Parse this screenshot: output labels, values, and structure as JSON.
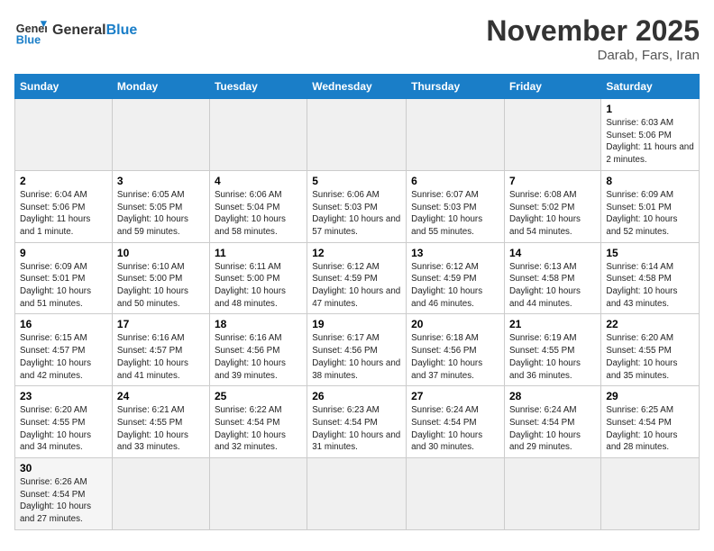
{
  "header": {
    "logo_line1": "General",
    "logo_line2": "Blue",
    "title": "November 2025",
    "subtitle": "Darab, Fars, Iran"
  },
  "weekdays": [
    "Sunday",
    "Monday",
    "Tuesday",
    "Wednesday",
    "Thursday",
    "Friday",
    "Saturday"
  ],
  "weeks": [
    [
      {
        "day": "",
        "empty": true
      },
      {
        "day": "",
        "empty": true
      },
      {
        "day": "",
        "empty": true
      },
      {
        "day": "",
        "empty": true
      },
      {
        "day": "",
        "empty": true
      },
      {
        "day": "",
        "empty": true
      },
      {
        "day": "1",
        "sunrise": "6:03 AM",
        "sunset": "5:06 PM",
        "daylight": "11 hours and 2 minutes."
      }
    ],
    [
      {
        "day": "2",
        "sunrise": "6:04 AM",
        "sunset": "5:06 PM",
        "daylight": "11 hours and 1 minute."
      },
      {
        "day": "3",
        "sunrise": "6:05 AM",
        "sunset": "5:05 PM",
        "daylight": "10 hours and 59 minutes."
      },
      {
        "day": "4",
        "sunrise": "6:06 AM",
        "sunset": "5:04 PM",
        "daylight": "10 hours and 58 minutes."
      },
      {
        "day": "5",
        "sunrise": "6:06 AM",
        "sunset": "5:03 PM",
        "daylight": "10 hours and 57 minutes."
      },
      {
        "day": "6",
        "sunrise": "6:07 AM",
        "sunset": "5:03 PM",
        "daylight": "10 hours and 55 minutes."
      },
      {
        "day": "7",
        "sunrise": "6:08 AM",
        "sunset": "5:02 PM",
        "daylight": "10 hours and 54 minutes."
      },
      {
        "day": "8",
        "sunrise": "6:09 AM",
        "sunset": "5:01 PM",
        "daylight": "10 hours and 52 minutes."
      }
    ],
    [
      {
        "day": "9",
        "sunrise": "6:09 AM",
        "sunset": "5:01 PM",
        "daylight": "10 hours and 51 minutes."
      },
      {
        "day": "10",
        "sunrise": "6:10 AM",
        "sunset": "5:00 PM",
        "daylight": "10 hours and 50 minutes."
      },
      {
        "day": "11",
        "sunrise": "6:11 AM",
        "sunset": "5:00 PM",
        "daylight": "10 hours and 48 minutes."
      },
      {
        "day": "12",
        "sunrise": "6:12 AM",
        "sunset": "4:59 PM",
        "daylight": "10 hours and 47 minutes."
      },
      {
        "day": "13",
        "sunrise": "6:12 AM",
        "sunset": "4:59 PM",
        "daylight": "10 hours and 46 minutes."
      },
      {
        "day": "14",
        "sunrise": "6:13 AM",
        "sunset": "4:58 PM",
        "daylight": "10 hours and 44 minutes."
      },
      {
        "day": "15",
        "sunrise": "6:14 AM",
        "sunset": "4:58 PM",
        "daylight": "10 hours and 43 minutes."
      }
    ],
    [
      {
        "day": "16",
        "sunrise": "6:15 AM",
        "sunset": "4:57 PM",
        "daylight": "10 hours and 42 minutes."
      },
      {
        "day": "17",
        "sunrise": "6:16 AM",
        "sunset": "4:57 PM",
        "daylight": "10 hours and 41 minutes."
      },
      {
        "day": "18",
        "sunrise": "6:16 AM",
        "sunset": "4:56 PM",
        "daylight": "10 hours and 39 minutes."
      },
      {
        "day": "19",
        "sunrise": "6:17 AM",
        "sunset": "4:56 PM",
        "daylight": "10 hours and 38 minutes."
      },
      {
        "day": "20",
        "sunrise": "6:18 AM",
        "sunset": "4:56 PM",
        "daylight": "10 hours and 37 minutes."
      },
      {
        "day": "21",
        "sunrise": "6:19 AM",
        "sunset": "4:55 PM",
        "daylight": "10 hours and 36 minutes."
      },
      {
        "day": "22",
        "sunrise": "6:20 AM",
        "sunset": "4:55 PM",
        "daylight": "10 hours and 35 minutes."
      }
    ],
    [
      {
        "day": "23",
        "sunrise": "6:20 AM",
        "sunset": "4:55 PM",
        "daylight": "10 hours and 34 minutes."
      },
      {
        "day": "24",
        "sunrise": "6:21 AM",
        "sunset": "4:55 PM",
        "daylight": "10 hours and 33 minutes."
      },
      {
        "day": "25",
        "sunrise": "6:22 AM",
        "sunset": "4:54 PM",
        "daylight": "10 hours and 32 minutes."
      },
      {
        "day": "26",
        "sunrise": "6:23 AM",
        "sunset": "4:54 PM",
        "daylight": "10 hours and 31 minutes."
      },
      {
        "day": "27",
        "sunrise": "6:24 AM",
        "sunset": "4:54 PM",
        "daylight": "10 hours and 30 minutes."
      },
      {
        "day": "28",
        "sunrise": "6:24 AM",
        "sunset": "4:54 PM",
        "daylight": "10 hours and 29 minutes."
      },
      {
        "day": "29",
        "sunrise": "6:25 AM",
        "sunset": "4:54 PM",
        "daylight": "10 hours and 28 minutes."
      }
    ],
    [
      {
        "day": "30",
        "sunrise": "6:26 AM",
        "sunset": "4:54 PM",
        "daylight": "10 hours and 27 minutes."
      },
      {
        "day": "",
        "empty": true
      },
      {
        "day": "",
        "empty": true
      },
      {
        "day": "",
        "empty": true
      },
      {
        "day": "",
        "empty": true
      },
      {
        "day": "",
        "empty": true
      },
      {
        "day": "",
        "empty": true
      }
    ]
  ]
}
